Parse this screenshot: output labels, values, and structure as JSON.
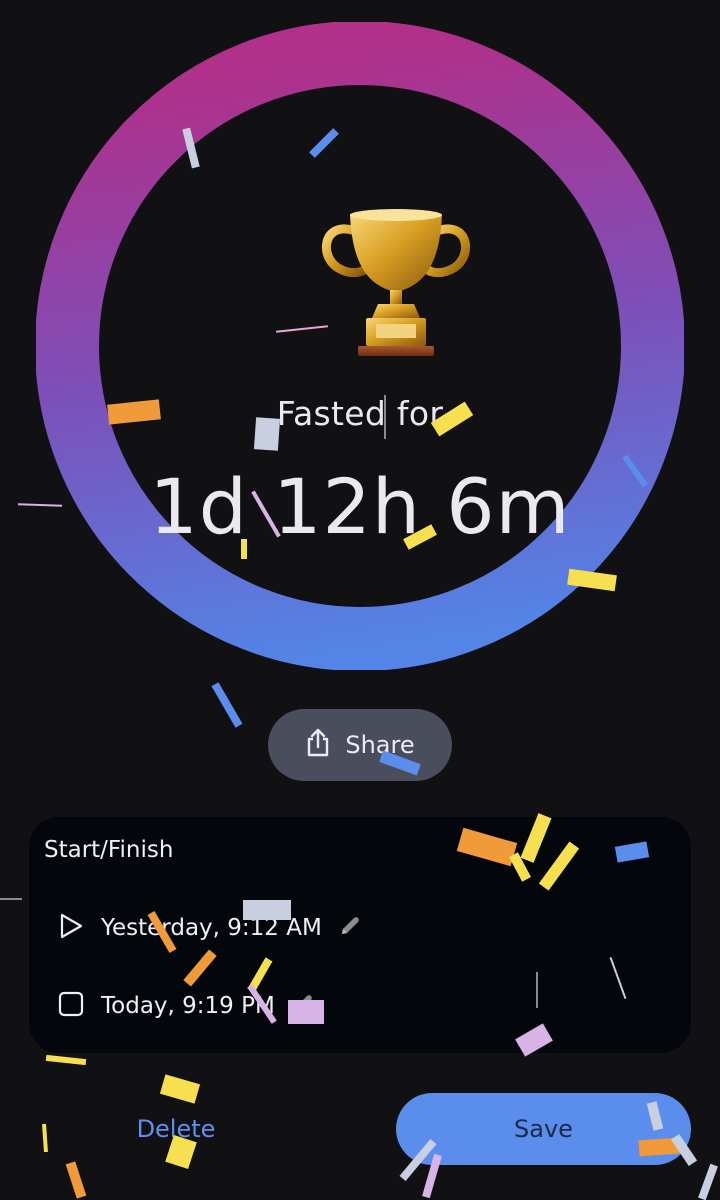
{
  "timer": {
    "label": "Fasted for",
    "duration": "1d 12h 6m",
    "progress": 1.0,
    "ring_gradient": [
      "#b0308a",
      "#7d4fb8",
      "#5384e6"
    ]
  },
  "icons": {
    "trophy": "trophy-icon",
    "share": "share-icon",
    "start": "play-icon",
    "end": "stop-icon",
    "edit": "pencil-icon"
  },
  "share": {
    "label": "Share"
  },
  "times": {
    "title": "Start/Finish",
    "start": "Yesterday, 9:12 AM",
    "end": "Today, 9:19 PM"
  },
  "actions": {
    "delete_label": "Delete",
    "save_label": "Save"
  },
  "colors": {
    "background": "#111114",
    "card": "#03060b",
    "accent_blue": "#5a8dec",
    "share_button": "#4a4e5c"
  }
}
